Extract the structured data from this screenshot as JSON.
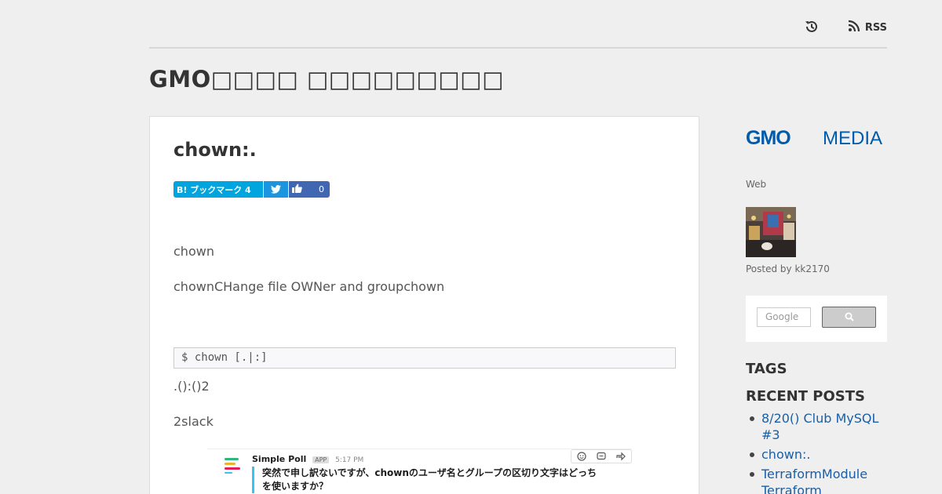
{
  "header": {
    "rss_label": "RSS",
    "blog_title": "GMO□□□□ □□□□□□□□□"
  },
  "article": {
    "title": "chown:.",
    "hatena_label": "B! ブックマーク 4",
    "fb_count": "0",
    "para1": " chown",
    "para2": "chownCHange file OWNer and groupchown",
    "code": "$ chown [.|:]",
    "para3": ".():()2",
    "para4": "2slack",
    "slack": {
      "name": "Simple Poll",
      "badge": "APP",
      "time": "5:17 PM",
      "message": "突然で申し訳ないですが、chownのユーザ名とグループの区切り文字はどっちを使いますか？"
    }
  },
  "sidebar": {
    "logo_gmo": "GMO",
    "logo_media": "MEDIA",
    "label": "Web",
    "posted_by": "Posted by kk2170",
    "search_placeholder": "Google",
    "tags_heading": "TAGS",
    "recent_heading": "RECENT POSTS",
    "recent_posts": [
      "8/20() Club MySQL #3",
      "chown:.",
      "TerraformModule Terraform"
    ]
  }
}
